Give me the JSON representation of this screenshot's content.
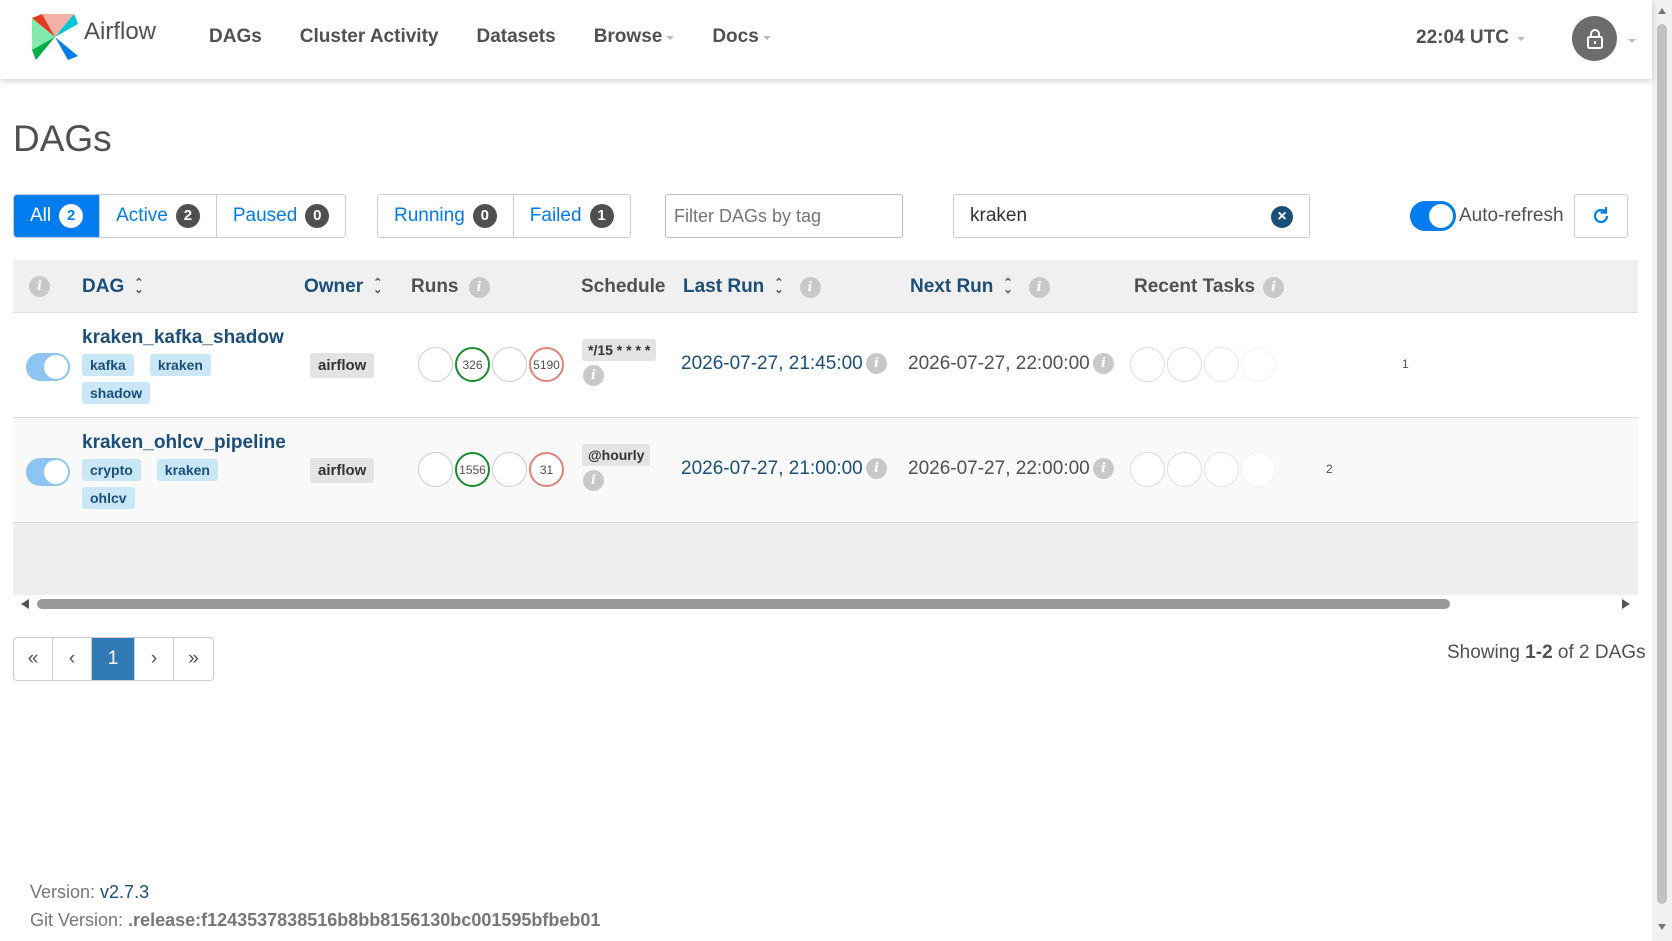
{
  "nav": {
    "brand": "Airflow",
    "links": [
      {
        "label": "DAGs",
        "caret": false
      },
      {
        "label": "Cluster Activity",
        "caret": false
      },
      {
        "label": "Datasets",
        "caret": false
      },
      {
        "label": "Browse",
        "caret": true
      },
      {
        "label": "Docs",
        "caret": true
      }
    ],
    "clock": "22:04 UTC"
  },
  "page_title": "DAGs",
  "filters": {
    "all": {
      "label": "All",
      "count": "2"
    },
    "active": {
      "label": "Active",
      "count": "2"
    },
    "paused": {
      "label": "Paused",
      "count": "0"
    },
    "running": {
      "label": "Running",
      "count": "0"
    },
    "failed": {
      "label": "Failed",
      "count": "1"
    },
    "tag_placeholder": "Filter DAGs by tag",
    "search_value": "kraken",
    "auto_refresh": "Auto-refresh"
  },
  "table": {
    "headers": {
      "dag": "DAG",
      "owner": "Owner",
      "runs": "Runs",
      "schedule": "Schedule",
      "last_run": "Last Run",
      "next_run": "Next Run",
      "recent_tasks": "Recent Tasks"
    },
    "rows": [
      {
        "name": "kraken_kafka_shadow",
        "tags": [
          "kafka",
          "kraken",
          "shadow"
        ],
        "owner": "airflow",
        "runs": [
          "",
          "326",
          "",
          "5190"
        ],
        "schedule": "*/15 * * * *",
        "last_run": "2026-07-27, 21:45:00",
        "next_run": "2026-07-27, 22:00:00",
        "recent_tasks_count": "1"
      },
      {
        "name": "kraken_ohlcv_pipeline",
        "tags": [
          "crypto",
          "kraken",
          "ohlcv"
        ],
        "owner": "airflow",
        "runs": [
          "",
          "1556",
          "",
          "31"
        ],
        "schedule": "@hourly",
        "last_run": "2026-07-27, 21:00:00",
        "next_run": "2026-07-27, 22:00:00",
        "recent_tasks_count": "2"
      }
    ]
  },
  "pagination": {
    "first": "«",
    "prev": "‹",
    "current": "1",
    "next": "›",
    "last": "»",
    "showing_prefix": "Showing ",
    "showing_range": "1-2",
    "showing_suffix": " of 2 DAGs"
  },
  "footer": {
    "version_label": "Version: ",
    "version": "v2.7.3",
    "git_label": "Git Version: ",
    "git_version": ".release:f1243537838516b8bb8156130bc001595bfbeb01"
  },
  "colors": {
    "primary": "#017cee",
    "link": "#1c4e7a",
    "success": "#1b8a2e",
    "failed": "#e0817a"
  }
}
